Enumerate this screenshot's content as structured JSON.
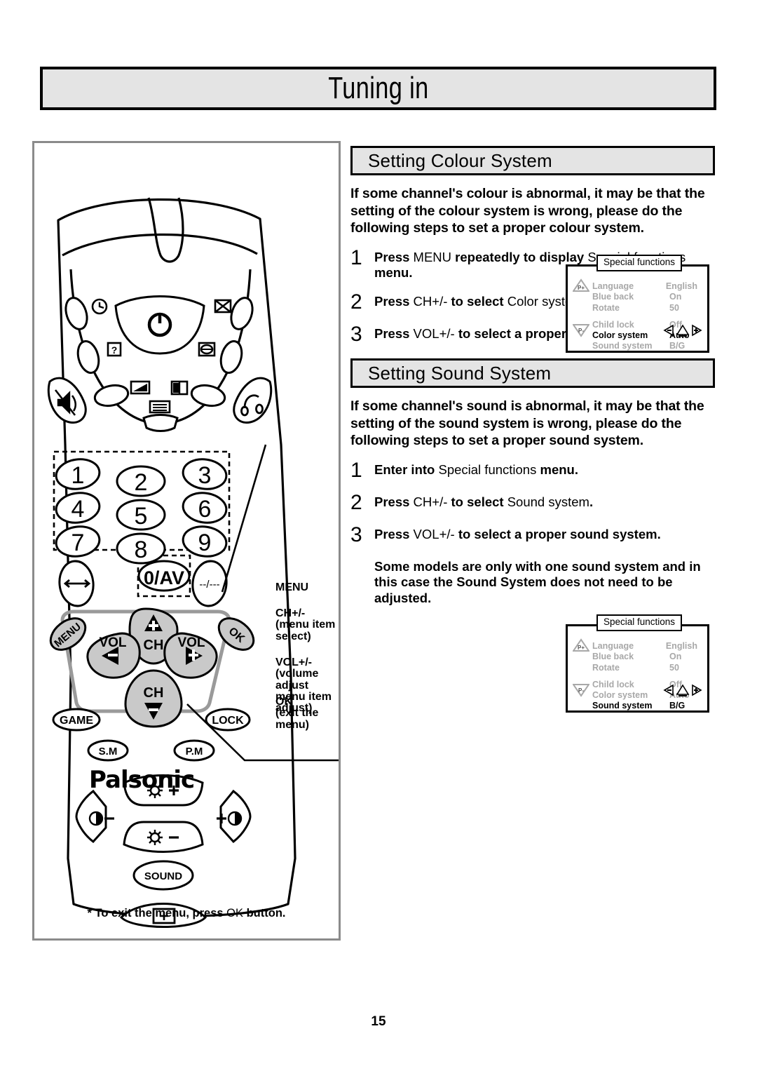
{
  "page": {
    "title": "Tuning in",
    "number": "15"
  },
  "remote_panel": {
    "brand": "Palsonic",
    "exit_note_prefix": "* To exit the menu, press ",
    "exit_note_key": "OK",
    "exit_note_suffix": " button.",
    "keypad": [
      "1",
      "2",
      "3",
      "4",
      "5",
      "6",
      "7",
      "8",
      "9"
    ],
    "zero_av": "0/AV",
    "dash_key": "--/---",
    "nav": {
      "menu": "MENU",
      "ok": "OK",
      "vol_left": "VOL",
      "vol_right": "VOL",
      "ch_up": "CH",
      "ch_down": "CH"
    },
    "small_buttons": {
      "game": "GAME",
      "lock": "LOCK",
      "sound_mode": "S.M",
      "picture_mode": "P.M",
      "sound": "SOUND"
    },
    "icon_buttons": {
      "clock": "clock-icon",
      "power": "power-icon",
      "mute": "mute-icon",
      "headphone": "headphone-icon",
      "help": "question-icon",
      "swap": "swap-icon",
      "picture": "picture-icon",
      "split": "split-screen-icon",
      "list": "list-icon",
      "contrast_minus": "contrast-minus-icon",
      "contrast_plus": "contrast-plus-icon",
      "brightness_plus": "brightness-plus-icon",
      "brightness_minus": "brightness-minus-icon",
      "screen": "screen-size-icon",
      "arrow_swap": "left-right-arrow-icon"
    },
    "callouts": [
      {
        "title": "MENU",
        "sub": ""
      },
      {
        "title": "CH+/-",
        "sub": "(menu item\nselect)"
      },
      {
        "title": "VOL+/-",
        "sub": "(volume adjust\nmenu item adjust)"
      },
      {
        "title": "OK",
        "sub": "(exit the menu)"
      }
    ]
  },
  "colour_section": {
    "heading": "Setting Colour System",
    "intro": "If some channel's colour is abnormal, it may be that the setting of the colour system is wrong, please do the following steps to set a proper colour system.",
    "steps": [
      {
        "num": "1",
        "parts": [
          {
            "t": "Press ",
            "b": true
          },
          {
            "t": "MENU ",
            "b": false
          },
          {
            "t": "repeatedly to display ",
            "b": true
          },
          {
            "t": "Special functions ",
            "b": false
          },
          {
            "t": "menu.",
            "b": true
          }
        ]
      },
      {
        "num": "2",
        "parts": [
          {
            "t": "Press ",
            "b": true
          },
          {
            "t": "CH+/- ",
            "b": false
          },
          {
            "t": "to select ",
            "b": true
          },
          {
            "t": "Color system",
            "b": false
          },
          {
            "t": ".",
            "b": true
          }
        ]
      },
      {
        "num": "3",
        "parts": [
          {
            "t": "Press ",
            "b": true
          },
          {
            "t": "VOL+/- ",
            "b": false
          },
          {
            "t": "to select a proper colour system.",
            "b": true
          }
        ]
      }
    ]
  },
  "sound_section": {
    "heading": "Setting Sound System",
    "intro": "If some channel's sound is abnormal, it may be that the setting of the sound system is wrong, please do the following steps to set a proper sound system.",
    "steps": [
      {
        "num": "1",
        "parts": [
          {
            "t": "Enter into ",
            "b": true
          },
          {
            "t": "Special functions ",
            "b": false
          },
          {
            "t": "menu.",
            "b": true
          }
        ]
      },
      {
        "num": "2",
        "parts": [
          {
            "t": "Press ",
            "b": true
          },
          {
            "t": "CH+/- ",
            "b": false
          },
          {
            "t": "to select ",
            "b": true
          },
          {
            "t": "Sound system",
            "b": false
          },
          {
            "t": ".",
            "b": true
          }
        ]
      },
      {
        "num": "3",
        "parts": [
          {
            "t": "Press ",
            "b": true
          },
          {
            "t": "VOL+/- ",
            "b": false
          },
          {
            "t": "to select a proper sound system.",
            "b": true
          }
        ]
      }
    ],
    "note": "Some models are only with one sound system and in this case the Sound System does not need to be adjusted."
  },
  "osd_colour": {
    "title": "Special functions",
    "rows_group1": [
      {
        "label": "Language",
        "value": "English",
        "highlighted": false
      },
      {
        "label": "Blue back",
        "value": "On",
        "highlighted": false
      },
      {
        "label": "Rotate",
        "value": "50",
        "highlighted": false
      }
    ],
    "rows_group2": [
      {
        "label": "Child lock",
        "value": "Off",
        "highlighted": false
      },
      {
        "label": "Color system",
        "value": "Auto",
        "highlighted": true
      },
      {
        "label": "Sound system",
        "value": "B/G",
        "highlighted": false
      }
    ],
    "p_up": "P+",
    "p_down": "P-",
    "arrow_minus": "-",
    "arrow_plus": "+"
  },
  "osd_sound": {
    "title": "Special functions",
    "rows_group1": [
      {
        "label": "Language",
        "value": "English",
        "highlighted": false
      },
      {
        "label": "Blue back",
        "value": "On",
        "highlighted": false
      },
      {
        "label": "Rotate",
        "value": "50",
        "highlighted": false
      }
    ],
    "rows_group2": [
      {
        "label": "Child lock",
        "value": "Off",
        "highlighted": false
      },
      {
        "label": "Color system",
        "value": "Auto",
        "highlighted": false
      },
      {
        "label": "Sound system",
        "value": "B/G",
        "highlighted": true
      }
    ],
    "p_up": "P+",
    "p_down": "P-",
    "arrow_minus": "-",
    "arrow_plus": "+"
  }
}
